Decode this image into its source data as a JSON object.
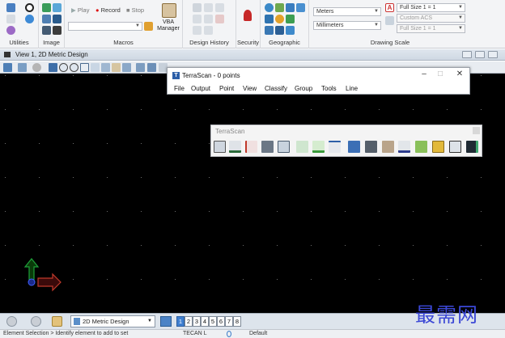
{
  "ribbon": {
    "groups": {
      "utilities": "Utilities",
      "image": "Image",
      "macros": "Macros",
      "design_history": "Design History",
      "security": "Security",
      "geographic": "Geographic",
      "drawing_scale": "Drawing Scale"
    },
    "macros": {
      "play_label": "Play",
      "record_label": "Record",
      "stop_label": "Stop",
      "vba_label_1": "VBA",
      "vba_label_2": "Manager",
      "macro_select": ""
    },
    "drawing_scale": {
      "units_primary": "Meters",
      "units_secondary": "Millimeters",
      "scale_1": "Full Size 1 = 1",
      "acs": "Custom ACS",
      "scale_2": "Full Size 1 = 1"
    }
  },
  "view": {
    "title": "View 1, 2D Metric Design"
  },
  "terrascan_main": {
    "title": "TerraScan - 0 points",
    "menu": [
      "File",
      "Output",
      "Point",
      "View",
      "Classify",
      "Group",
      "Tools",
      "Line"
    ]
  },
  "terrascan_toolbar": {
    "title": "TerraScan"
  },
  "navbar": {
    "model": "2D Metric Design",
    "views": [
      "1",
      "2",
      "3",
      "4",
      "5",
      "6",
      "7",
      "8"
    ],
    "active_view": "1"
  },
  "status": {
    "prompt": "Element Selection > Identify element to add to set",
    "level": "TECAN L",
    "model_label": "Default"
  },
  "watermark": "最需网",
  "colors": {
    "canvas": "#000000",
    "accent": "#3f7fd0",
    "watermark": "#3b47d6"
  }
}
